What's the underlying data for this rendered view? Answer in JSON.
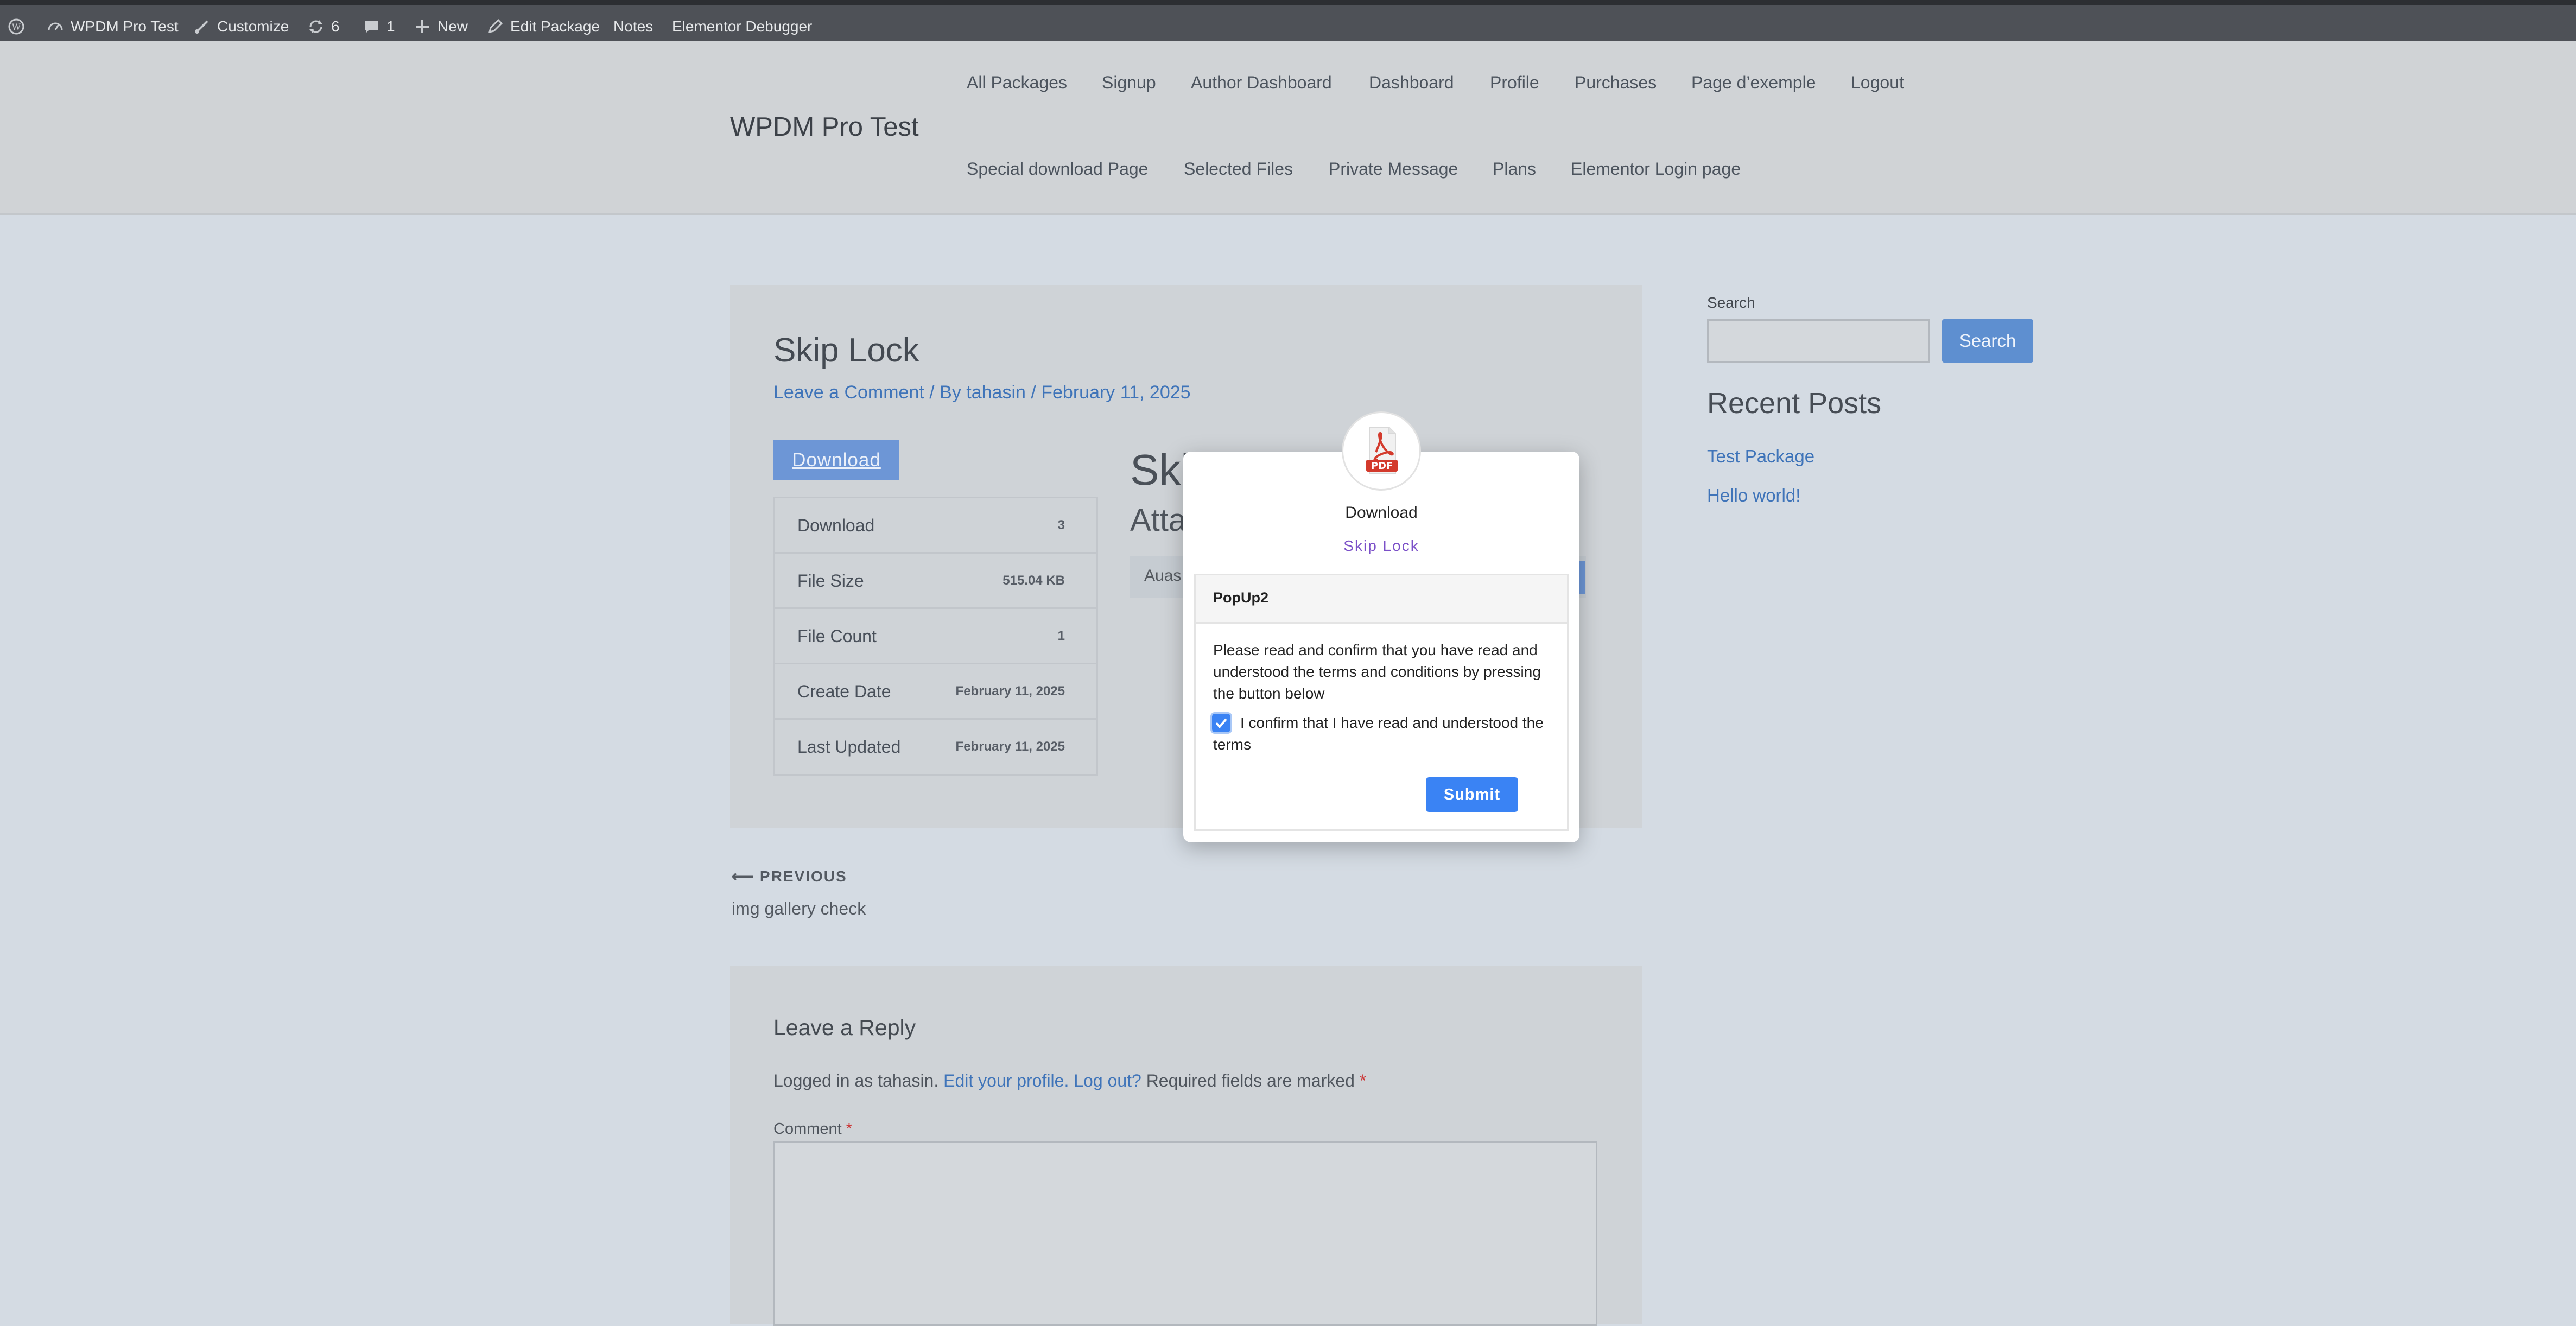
{
  "admin_bar": {
    "site_name": "WPDM Pro Test",
    "customize": "Customize",
    "updates_count": "6",
    "comments_count": "1",
    "new": "New",
    "edit_package": "Edit Package",
    "notes": "Notes",
    "elementor_debugger": "Elementor Debugger"
  },
  "header": {
    "site_title": "WPDM Pro Test",
    "nav_primary": [
      "All Packages",
      "Signup",
      "Author Dashboard",
      "Dashboard",
      "Profile",
      "Purchases",
      "Page d’exemple",
      "Logout"
    ],
    "nav_secondary": [
      "Special download Page",
      "Selected Files",
      "Private Message",
      "Plans",
      "Elementor Login page"
    ]
  },
  "article": {
    "title": "Skip Lock",
    "meta": "Leave a Comment / By tahasin / February 11, 2025",
    "download_button": "Download",
    "info": [
      {
        "label": "Download",
        "value": "3"
      },
      {
        "label": "File Size",
        "value": "515.04 KB"
      },
      {
        "label": "File Count",
        "value": "1"
      },
      {
        "label": "Create Date",
        "value": "February 11, 2025"
      },
      {
        "label": "Last Updated",
        "value": "February 11, 2025"
      }
    ],
    "content_title": "Ski",
    "attachments_title": "Atta",
    "file_name": "Auas"
  },
  "post_nav": {
    "previous_label": "PREVIOUS",
    "previous_title": "img gallery check"
  },
  "reply": {
    "title": "Leave a Reply",
    "logged_in_prefix": "Logged in as tahasin.",
    "edit_profile": "Edit your profile.",
    "log_out": "Log out?",
    "required_text": "Required fields are marked",
    "required_mark": "*",
    "comment_label": "Comment"
  },
  "sidebar": {
    "search_label": "Search",
    "search_button": "Search",
    "recent_title": "Recent Posts",
    "recent_posts": [
      "Test Package",
      "Hello world!"
    ]
  },
  "modal": {
    "icon_text": "PDF",
    "title": "Download",
    "subtitle": "Skip Lock",
    "panel_title": "PopUp2",
    "message": "Please read and confirm that you have read and understood the terms and conditions by pressing the button below",
    "checkbox_label": "I confirm that I have read and understood the terms",
    "checkbox_checked": true,
    "submit": "Submit",
    "accent": "#3a83f4"
  }
}
